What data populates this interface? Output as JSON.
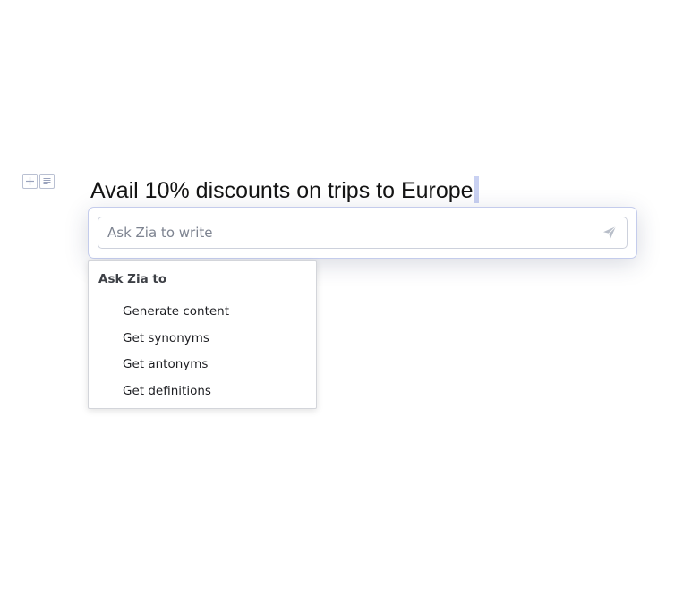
{
  "editor": {
    "heading_text": "Avail 10% discounts on trips to Europe"
  },
  "block_controls": {
    "add_icon": "plus-icon",
    "menu_icon": "paragraph-lines-icon"
  },
  "ask_box": {
    "placeholder": "Ask Zia to write",
    "send_icon": "send-arrow-icon"
  },
  "suggestions": {
    "title": "Ask Zia to",
    "items": [
      {
        "label": "Generate content"
      },
      {
        "label": "Get synonyms"
      },
      {
        "label": "Get antonyms"
      },
      {
        "label": "Get definitions"
      }
    ]
  },
  "colors": {
    "accent_border": "#c4ccec",
    "caret": "#c9d1f2",
    "icon": "#9aa3bd"
  }
}
